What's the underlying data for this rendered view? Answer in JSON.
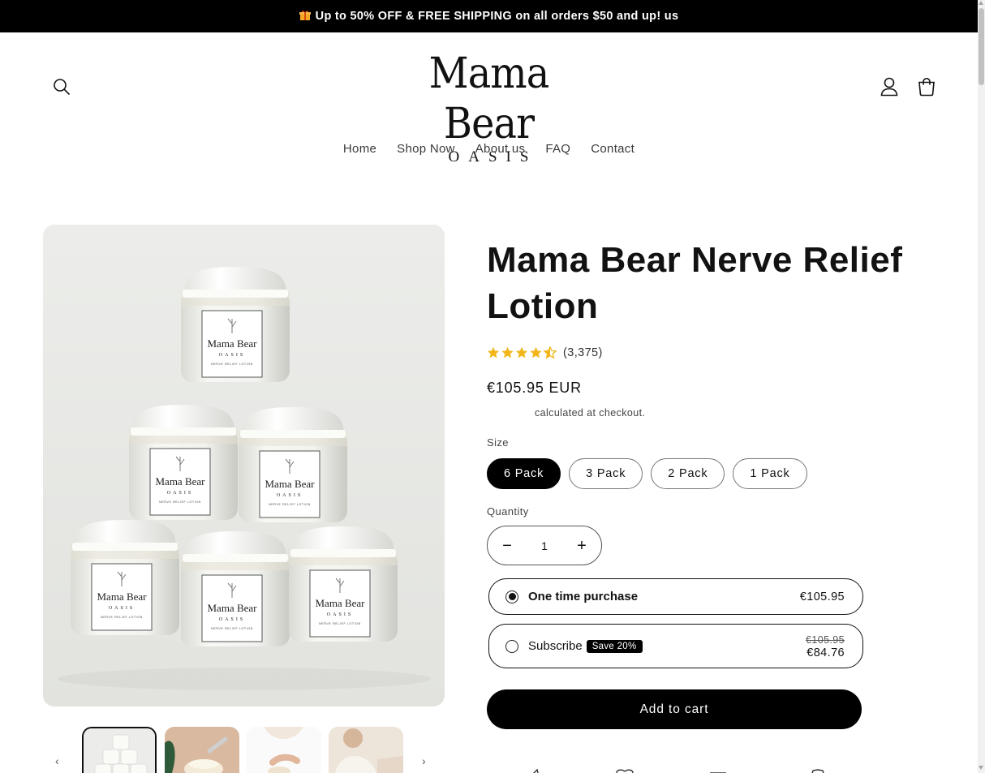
{
  "announcement": {
    "icon": "gift-icon",
    "text": "Up to 50% OFF & FREE SHIPPING on all orders $50 and up! us"
  },
  "header": {
    "logo_main": "Mama Bear",
    "logo_sub": "OASIS",
    "icons": [
      "search-icon",
      "account-icon",
      "cart-icon"
    ]
  },
  "nav": {
    "items": [
      "Home",
      "Shop Now",
      "About us",
      "FAQ",
      "Contact"
    ]
  },
  "product": {
    "title": "Mama Bear Nerve Relief Lotion",
    "rating": 4.5,
    "review_count": "(3,375)",
    "price": "€105.95 EUR",
    "tax_note": "calculated at checkout.",
    "jar_label_brand": "Mama Bear",
    "jar_label_sub": "OASIS",
    "jar_label_product": "NERVE RELIEF LOTION"
  },
  "size": {
    "label": "Size",
    "options": [
      "6 Pack",
      "3 Pack",
      "2 Pack",
      "1 Pack"
    ],
    "selected": "6 Pack"
  },
  "quantity": {
    "label": "Quantity",
    "value": "1",
    "minus": "−",
    "plus": "+"
  },
  "purchase_options": {
    "one_time": {
      "label": "One time purchase",
      "price": "€105.95",
      "selected": true
    },
    "subscribe": {
      "label": "Subscribe",
      "badge": "Save 20%",
      "original_price": "€105.95",
      "price": "€84.76",
      "selected": false
    }
  },
  "add_to_cart": {
    "label": "Add to cart"
  },
  "gallery": {
    "prev": "‹",
    "next": "›",
    "thumbnail_count": 4
  },
  "colors": {
    "accent": "#000000",
    "star": "#f2b61b",
    "background": "#ffffff",
    "image_bg": "#e9eae6"
  }
}
